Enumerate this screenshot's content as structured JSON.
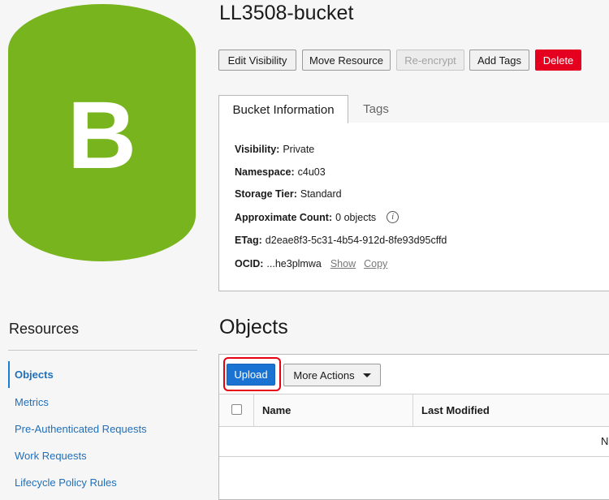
{
  "bucket": {
    "icon_letter": "B",
    "icon_color": "#78b41e",
    "name": "LL3508-bucket"
  },
  "actions": {
    "edit_visibility": "Edit Visibility",
    "move_resource": "Move Resource",
    "reencrypt": "Re-encrypt",
    "add_tags": "Add Tags",
    "delete": "Delete"
  },
  "tabs": [
    {
      "label": "Bucket Information",
      "active": true
    },
    {
      "label": "Tags",
      "active": false
    }
  ],
  "info": {
    "visibility_label": "Visibility:",
    "visibility_value": "Private",
    "namespace_label": "Namespace:",
    "namespace_value": "c4u03",
    "storage_tier_label": "Storage Tier:",
    "storage_tier_value": "Standard",
    "approx_count_label": "Approximate Count:",
    "approx_count_value": "0 objects",
    "info_glyph": "i",
    "etag_label": "ETag:",
    "etag_value": "d2eae8f3-5c31-4b54-912d-8fe93d95cffd",
    "ocid_label": "OCID:",
    "ocid_value": "...he3plmwa",
    "show_link": "Show",
    "copy_link": "Copy"
  },
  "resources": {
    "title": "Resources",
    "items": [
      {
        "label": "Objects",
        "active": true
      },
      {
        "label": "Metrics",
        "active": false
      },
      {
        "label": "Pre-Authenticated Requests",
        "active": false
      },
      {
        "label": "Work Requests",
        "active": false
      },
      {
        "label": "Lifecycle Policy Rules",
        "active": false
      }
    ]
  },
  "objects": {
    "title": "Objects",
    "upload_label": "Upload",
    "more_actions_label": "More Actions",
    "columns": [
      "Name",
      "Last Modified"
    ],
    "empty_text": "N"
  },
  "colors": {
    "brand_green": "#78b41e",
    "primary_blue": "#1a73d3",
    "danger_red": "#e6001f",
    "highlight_outline": "#e60012"
  }
}
